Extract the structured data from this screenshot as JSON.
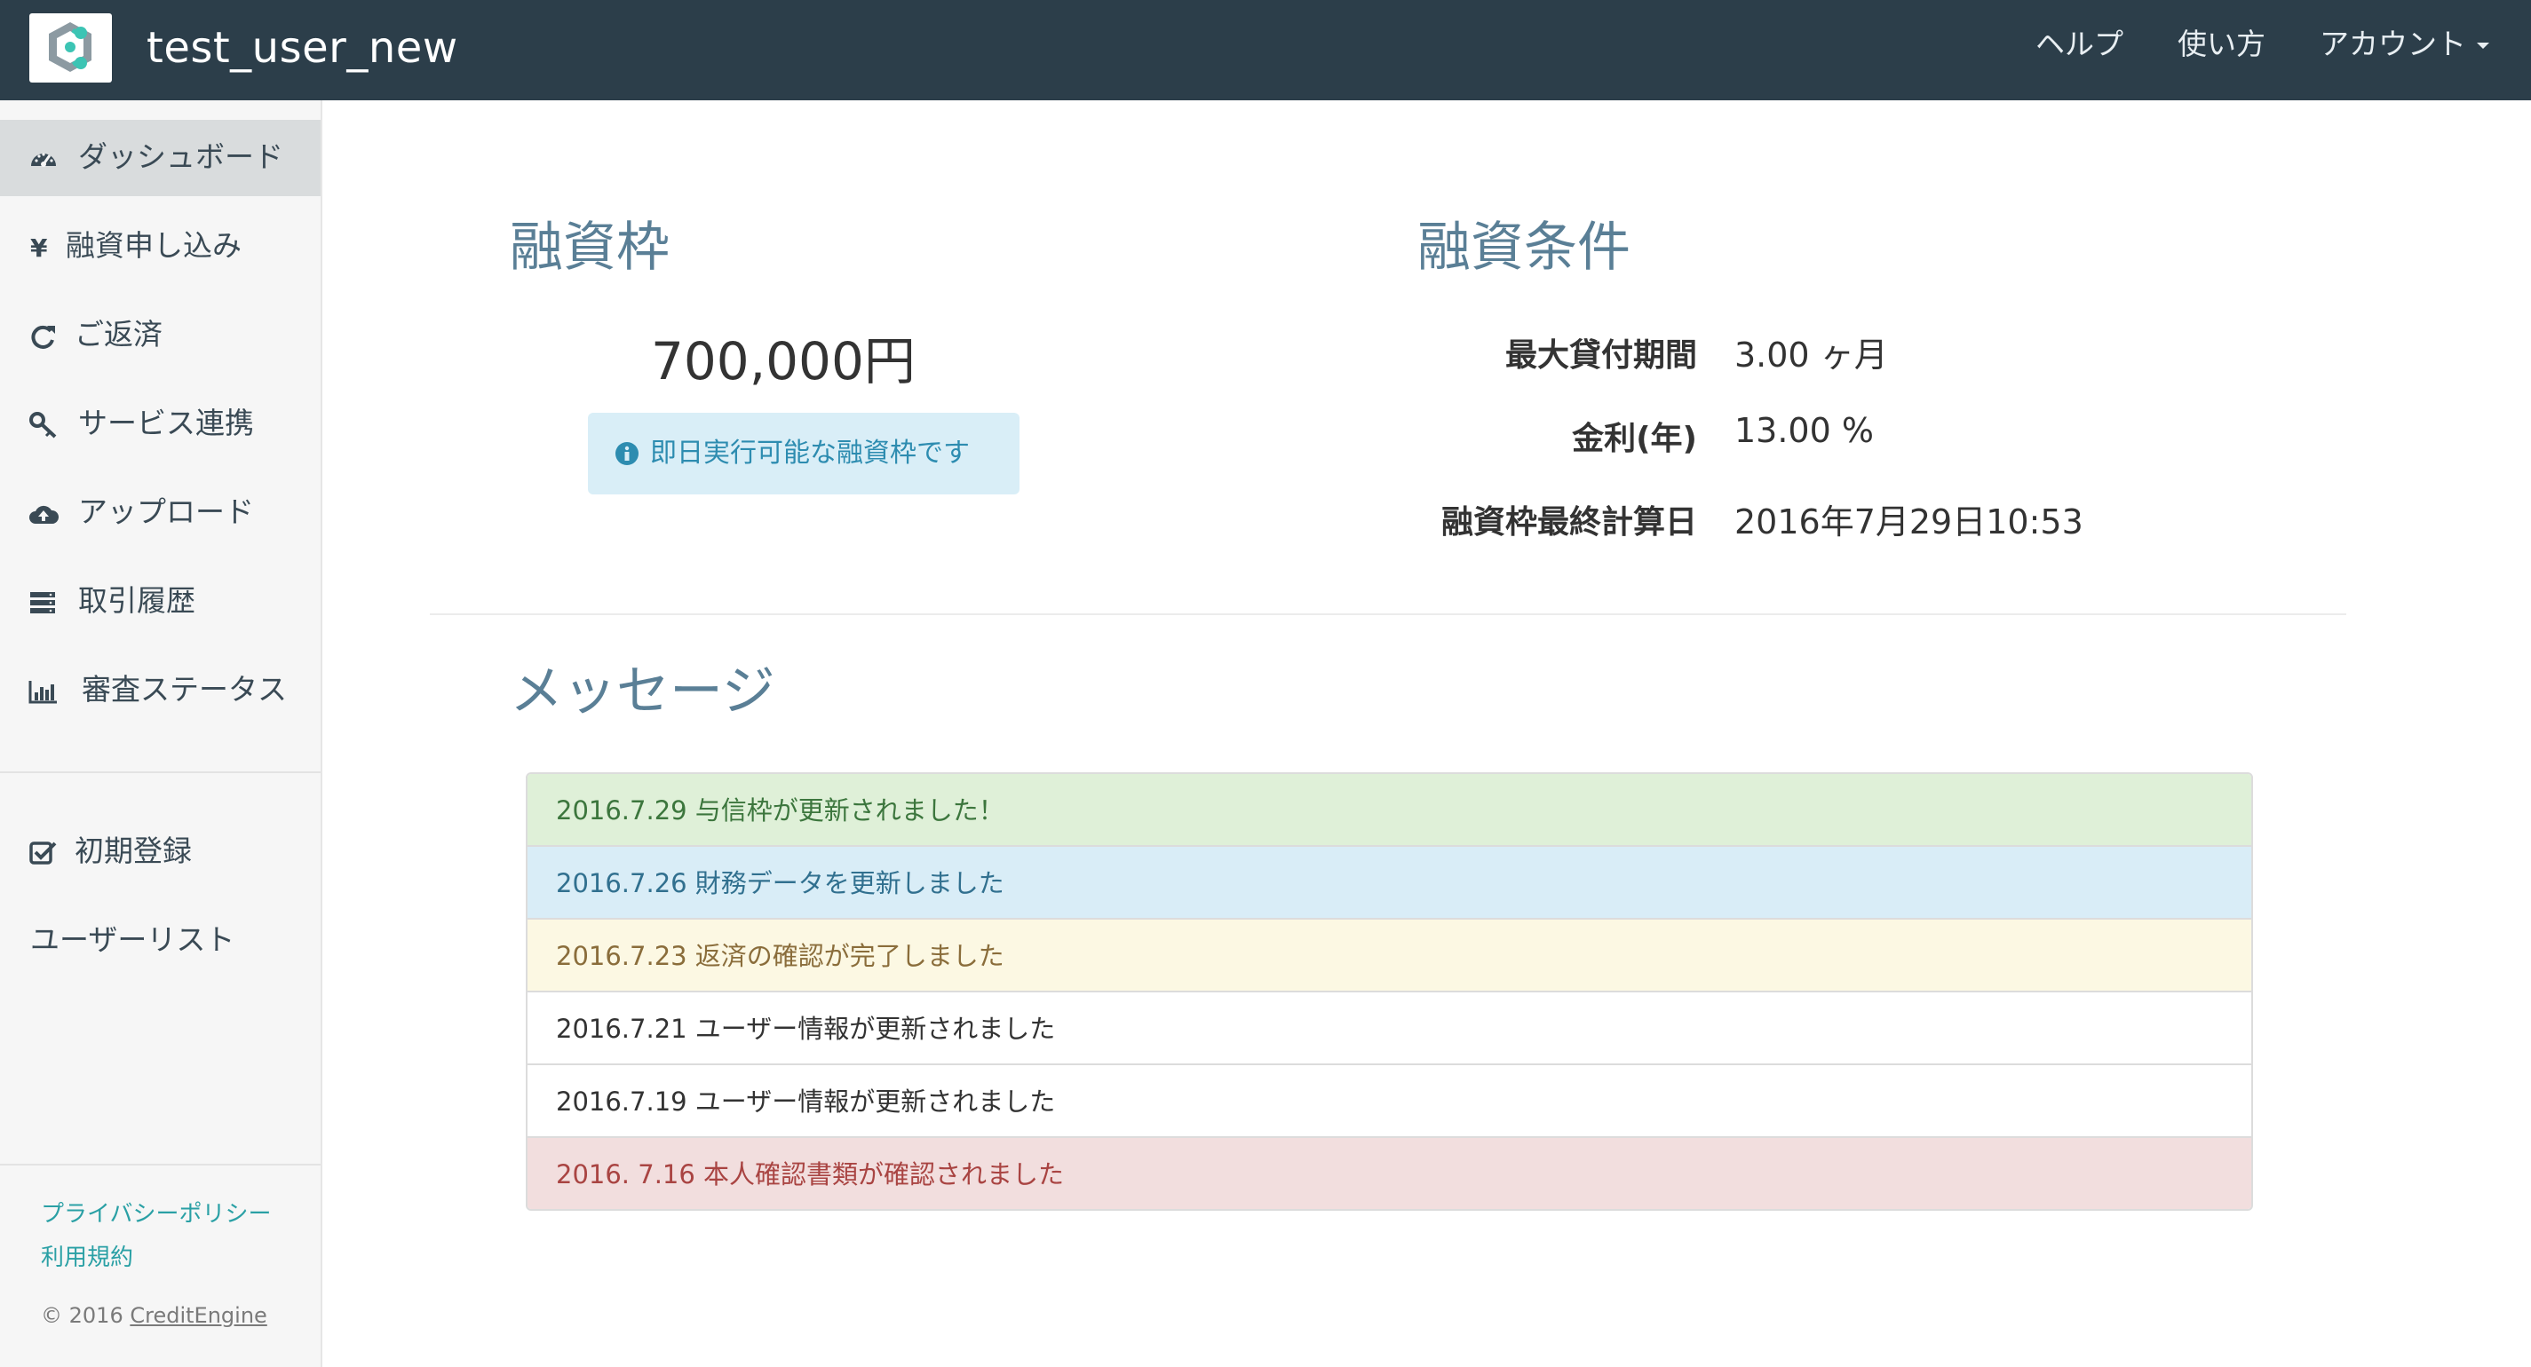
{
  "navbar": {
    "title": "test_user_new",
    "help_label": "ヘルプ",
    "usage_label": "使い方",
    "account_label": "アカウント",
    "logo_icon": "creditengine-logo-icon",
    "bg_color": "#2c3e4a"
  },
  "sidebar": {
    "items": [
      {
        "label": "ダッシュボード",
        "icon": "dashboard-gauge-icon",
        "active": true
      },
      {
        "label": "融資申し込み",
        "icon": "yen-icon",
        "active": false
      },
      {
        "label": "ご返済",
        "icon": "refresh-icon",
        "active": false
      },
      {
        "label": "サービス連携",
        "icon": "key-icon",
        "active": false
      },
      {
        "label": "アップロード",
        "icon": "cloud-upload-icon",
        "active": false
      },
      {
        "label": "取引履歴",
        "icon": "server-stack-icon",
        "active": false
      },
      {
        "label": "審査ステータス",
        "icon": "bar-chart-icon",
        "active": false
      }
    ],
    "secondary_items": [
      {
        "label": "初期登録",
        "icon": "checkbox-icon"
      },
      {
        "label": "ユーザーリスト",
        "icon": ""
      }
    ],
    "footer": {
      "privacy_label": "プライバシーポリシー",
      "terms_label": "利用規約",
      "copyright_prefix": "© 2016",
      "copyright_brand": "CreditEngine",
      "link_color": "#2aa0a5"
    }
  },
  "credit_limit": {
    "title": "融資枠",
    "amount": "700,000円",
    "notice": "即日実行可能な融資枠です",
    "notice_icon": "info-circle-icon"
  },
  "loan_terms": {
    "title": "融資条件",
    "rows": [
      {
        "label": "最大貸付期間",
        "value": "3.00 ヶ月"
      },
      {
        "label": "金利(年)",
        "value": "13.00 %"
      },
      {
        "label": "融資枠最終計算日",
        "value": "2016年7月29日10:53"
      }
    ]
  },
  "messages": {
    "title": "メッセージ",
    "items": [
      {
        "text": "2016.7.29 与信枠が更新されました！",
        "bg": "#dff0d8",
        "color": "#3c763d"
      },
      {
        "text": "2016.7.26 財務データを更新しました",
        "bg": "#d9edf7",
        "color": "#31708f"
      },
      {
        "text": "2016.7.23 返済の確認が完了しました",
        "bg": "#fcf8e3",
        "color": "#8a6d3b"
      },
      {
        "text": "2016.7.21 ユーザー情報が更新されました",
        "bg": "#ffffff",
        "color": "#333333"
      },
      {
        "text": "2016.7.19 ユーザー情報が更新されました",
        "bg": "#ffffff",
        "color": "#333333"
      },
      {
        "text": "2016. 7.16 本人確認書類が確認されました",
        "bg": "#f2dede",
        "color": "#a94442"
      }
    ]
  }
}
